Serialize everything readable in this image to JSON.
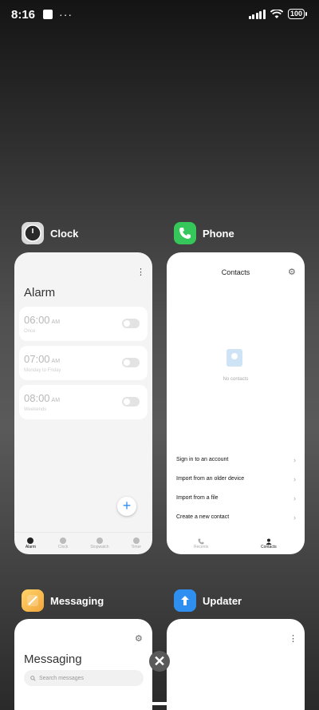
{
  "status_bar": {
    "time": "8:16",
    "ellipsis": "···",
    "battery": "100"
  },
  "apps": {
    "clock": {
      "name": "Clock",
      "alarm_title": "Alarm",
      "alarms": [
        {
          "time": "06:00",
          "ampm": "AM",
          "repeat": "Once"
        },
        {
          "time": "07:00",
          "ampm": "AM",
          "repeat": "Monday to Friday"
        },
        {
          "time": "08:00",
          "ampm": "AM",
          "repeat": "Weekends"
        }
      ],
      "fab": "+",
      "nav": [
        "Alarm",
        "Clock",
        "Stopwatch",
        "Timer"
      ]
    },
    "phone": {
      "name": "Phone",
      "title": "Contacts",
      "empty_text": "No contacts",
      "menu": [
        "Sign in to an account",
        "Import from an older device",
        "Import from a file",
        "Create a new contact"
      ],
      "nav": [
        "Recents",
        "Contacts"
      ]
    },
    "messaging": {
      "name": "Messaging",
      "title": "Messaging",
      "search_placeholder": "Search messages"
    },
    "updater": {
      "name": "Updater"
    }
  },
  "close_icon": "close-icon",
  "close_glyph": "✕",
  "colors": {
    "accent": "#2e8df2",
    "phone_icon": "#35c759",
    "updater_icon": "#2f8ff0"
  }
}
